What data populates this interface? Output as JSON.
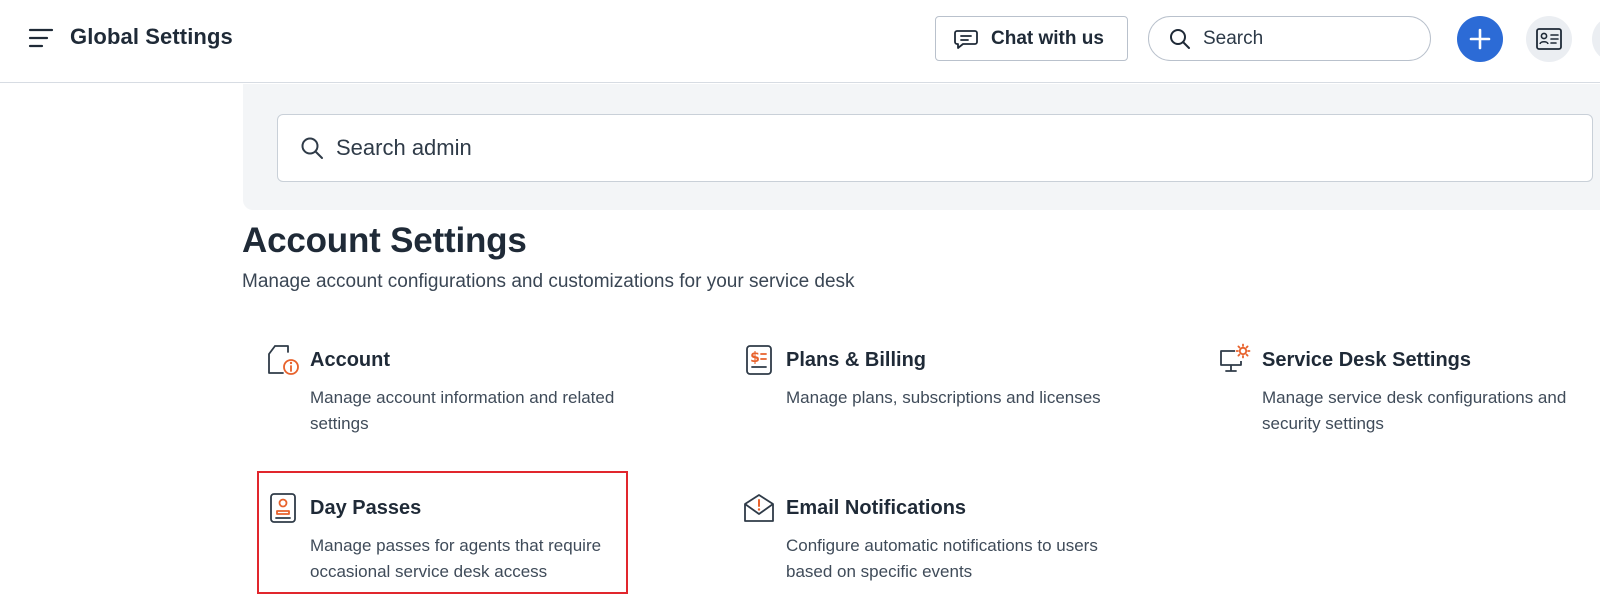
{
  "header": {
    "title": "Global Settings",
    "chat_label": "Chat with us",
    "search_placeholder": "Search"
  },
  "admin_search": {
    "placeholder": "Search admin"
  },
  "section": {
    "title": "Account Settings",
    "subtitle": "Manage account configurations and customizations for your service desk"
  },
  "cards": [
    {
      "title": "Account",
      "description": "Manage account information and related settings",
      "icon": "account-info-icon"
    },
    {
      "title": "Plans & Billing",
      "description": "Manage plans, subscriptions and licenses",
      "icon": "billing-icon"
    },
    {
      "title": "Service Desk Settings",
      "description": "Manage service desk configurations and security settings",
      "icon": "desk-settings-icon"
    },
    {
      "title": "Day Passes",
      "description": "Manage passes for agents that require occasional service desk access",
      "icon": "day-pass-icon"
    },
    {
      "title": "Email Notifications",
      "description": "Configure automatic notifications to users based on specific events",
      "icon": "email-notification-icon"
    }
  ],
  "colors": {
    "accent_blue": "#2c6bd6",
    "icon_orange": "#e8622c",
    "highlight_red": "#e1262d",
    "text_dark": "#1f2a37"
  }
}
